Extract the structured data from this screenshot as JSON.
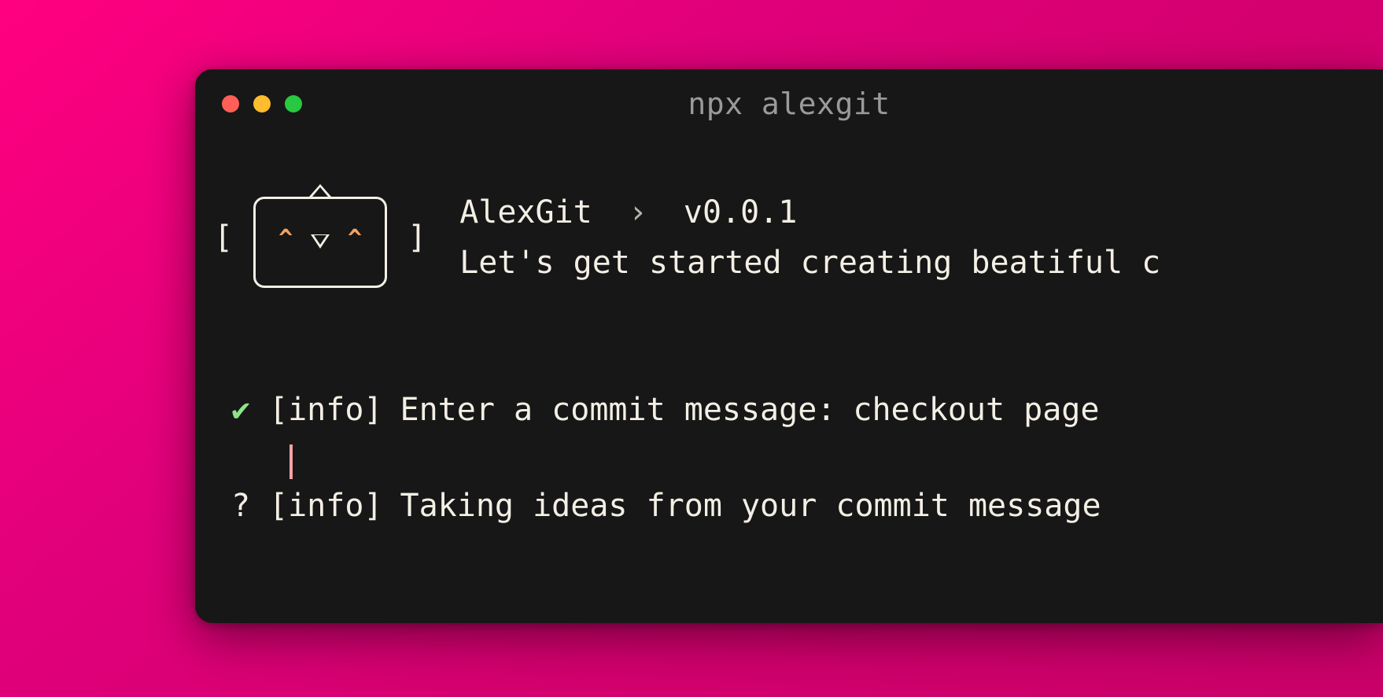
{
  "window": {
    "title": "npx alexgit"
  },
  "app": {
    "name": "AlexGit",
    "separator": "›",
    "version": "v0.0.1",
    "tagline": "Let's get started creating beatiful c"
  },
  "logo": {
    "eye_glyph": "^"
  },
  "output": {
    "line1": {
      "mark": "✔",
      "tag": "[info]",
      "prompt": "Enter a commit message:",
      "value": "checkout page"
    },
    "line2": {
      "mark": "?",
      "tag": "[info]",
      "text": "Taking ideas from your commit message"
    }
  }
}
